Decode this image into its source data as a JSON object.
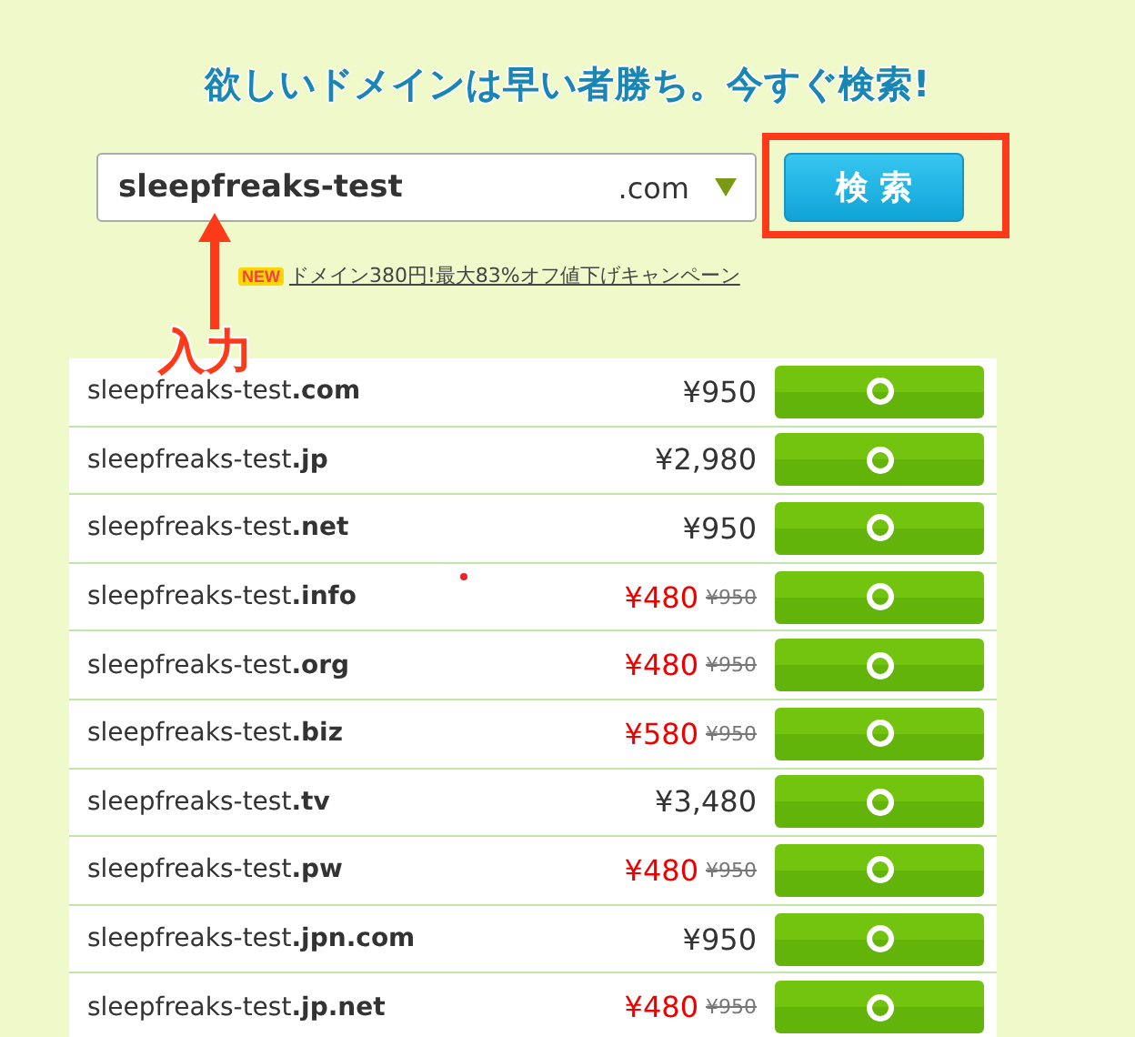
{
  "headline": "欲しいドメインは早い者勝ち。今すぐ検索!",
  "search": {
    "value": "sleepfreaks-test",
    "tld": ".com",
    "button": "検 索"
  },
  "campaign": {
    "badge": "NEW",
    "link": "ドメイン380円!最大83%オフ値下げキャンペーン"
  },
  "annotation": {
    "label": "入力"
  },
  "results": [
    {
      "domain": "sleepfreaks-test**.com**",
      "kind": "regular",
      "price": "¥950"
    },
    {
      "domain": "sleepfreaks-test**.jp**",
      "kind": "regular",
      "price": "¥2,980"
    },
    {
      "domain": "sleepfreaks-test**.net**",
      "kind": "regular",
      "price": "¥950"
    },
    {
      "domain": "sleepfreaks-test**.info**",
      "kind": "sale",
      "price": "¥480",
      "old_price": "¥950"
    },
    {
      "domain": "sleepfreaks-test**.org**",
      "kind": "sale",
      "price": "¥480",
      "old_price": "¥950"
    },
    {
      "domain": "sleepfreaks-test**.biz**",
      "kind": "sale",
      "price": "¥580",
      "old_price": "¥950"
    },
    {
      "domain": "sleepfreaks-test**.tv**",
      "kind": "regular",
      "price": "¥3,480"
    },
    {
      "domain": "sleepfreaks-test**.pw**",
      "kind": "sale",
      "price": "¥480",
      "old_price": "¥950"
    },
    {
      "domain": "sleepfreaks-test**.jpn.com**",
      "kind": "regular",
      "price": "¥950"
    },
    {
      "domain": "sleepfreaks-test**.jp.net**",
      "kind": "sale",
      "price": "¥480",
      "old_price": "¥950"
    }
  ]
}
